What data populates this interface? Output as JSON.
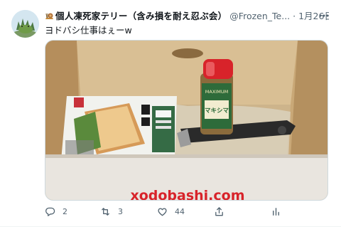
{
  "tweet": {
    "display_name": "個人凍死家テリー（含み損を耐え忍ぶ会）",
    "handle": "@Frozen_Te...",
    "separator": "·",
    "timestamp": "1月26日",
    "avatar_icon": "frog-avatar-icon",
    "name_emoji_icon": "snail-emoji-icon",
    "text": "ヨドバシ仕事はぇーw",
    "image_alt": "ヨドバシの段ボール箱に入ったホットサンドメーカーとマキシマムのスパイス瓶",
    "image_text": {
      "spice_label": "マキシマ",
      "spice_brand": "MAXIMUM",
      "box_print": "xodobashi.com"
    },
    "actions": {
      "reply_icon": "reply-icon",
      "reply_count": "2",
      "retweet_icon": "retweet-icon",
      "retweet_count": "3",
      "like_icon": "heart-icon",
      "like_count": "44",
      "share_icon": "share-icon",
      "analytics_icon": "analytics-icon"
    },
    "more_icon": "more-icon",
    "colors": {
      "text": "#0f1419",
      "secondary": "#536471",
      "border": "#cfd9de",
      "spice_cap": "#d8232a",
      "spice_label": "#2e6b3a",
      "box_print": "#d8232a"
    }
  }
}
